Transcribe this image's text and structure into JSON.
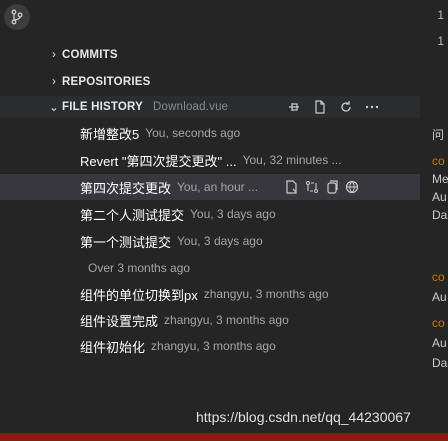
{
  "colors": {
    "bg": "#252526",
    "selected": "#37373d",
    "accent": "#cc7a00",
    "bottom_bar": "#8b1a14"
  },
  "top_numbers": [
    "1",
    "1"
  ],
  "sections": {
    "commits": "COMMITS",
    "repositories": "REPOSITORIES",
    "file_history": "FILE HISTORY",
    "file_history_desc": "Download.vue"
  },
  "icons": {
    "top": "source-control-icon",
    "header_actions": [
      "pin-icon",
      "file-icon",
      "refresh-icon",
      "more-icon"
    ],
    "row_actions": [
      "compare-file-icon",
      "git-compare-icon",
      "copy-icon",
      "globe-icon"
    ]
  },
  "commits": [
    {
      "message": "新增整改5",
      "meta": "You, seconds ago"
    },
    {
      "message": "Revert \"第四次提交更改\" ...",
      "meta": "You, 32 minutes ..."
    },
    {
      "message": "第四次提交更改",
      "meta": "You, an hour ..."
    },
    {
      "message": "第二个人测试提交",
      "meta": "You, 3 days ago"
    },
    {
      "message": "第一个测试提交",
      "meta": "You, 3 days ago"
    }
  ],
  "group_label": "Over 3 months ago",
  "older_commits": [
    {
      "message": "组件的单位切换到px",
      "meta": "zhangyu, 3 months ago"
    },
    {
      "message": "组件设置完成",
      "meta": "zhangyu, 3 months ago"
    },
    {
      "message": "组件初始化",
      "meta": "zhangyu, 3 months ago"
    }
  ],
  "right_panel": [
    "问",
    "co",
    "Me",
    "Au",
    "Da",
    "co",
    "Au",
    "co",
    "Au",
    "Da"
  ],
  "watermark": "https://blog.csdn.net/qq_44230067"
}
